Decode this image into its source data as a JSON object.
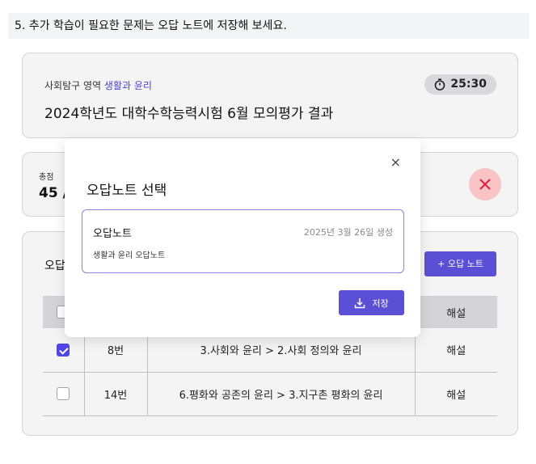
{
  "instruction": "5. 추가 학습이 필요한 문제는 오답 노트에 저장해 보세요.",
  "header": {
    "subject_prefix": "사회탐구 영역",
    "subject_name": "생활과 윤리",
    "exam_title": "2024학년도 대학수학능력시험 6월 모의평가 결과",
    "timer": "25:30",
    "timer_icon": "stopwatch-icon"
  },
  "score": {
    "label": "총점",
    "value": "45 /",
    "badge_icon": "x-icon"
  },
  "wrong_answers": {
    "title": "오답",
    "add_note_label": "+ 오답 노트",
    "header_last": "해설",
    "rows": [
      {
        "number": "8번",
        "unit": "3.사회와 윤리 > 2.사회 정의와 윤리",
        "explain": "해설",
        "checked": true
      },
      {
        "number": "14번",
        "unit": "6.평화와 공존의 윤리 > 3.지구촌 평화의 윤리",
        "explain": "해설",
        "checked": false
      }
    ]
  },
  "modal": {
    "close": "×",
    "title": "오답노트 선택",
    "note": {
      "name": "오답노트",
      "date": "2025년 3월 26일 생성",
      "description": "생활과 윤리 오답노트"
    },
    "save_label": "저장",
    "save_icon": "download-icon"
  },
  "colors": {
    "accent": "#5b4fd6",
    "badge_bg": "#f9c4c4",
    "badge_x": "#e11d48"
  }
}
